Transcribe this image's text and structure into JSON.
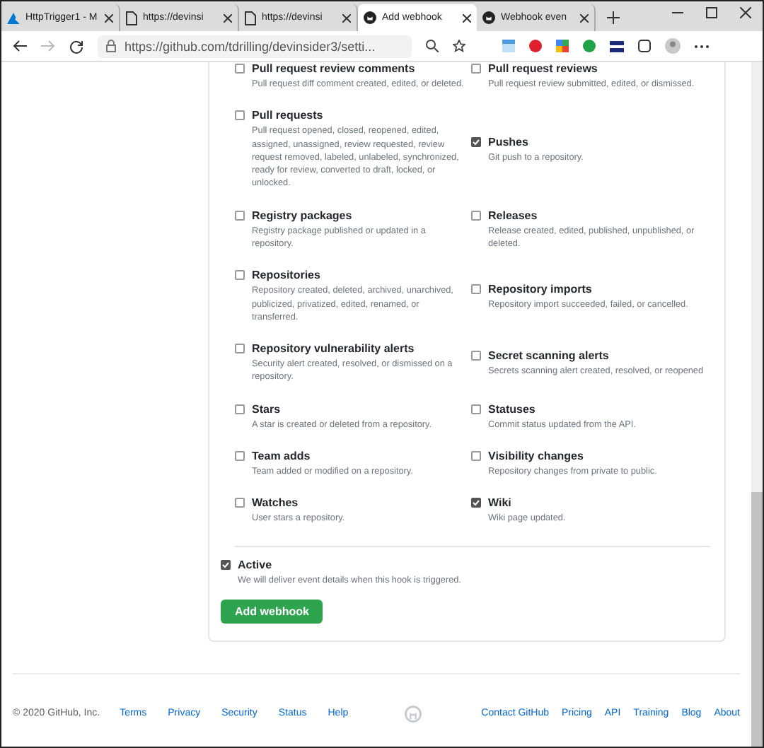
{
  "browser": {
    "tabs": [
      {
        "title": "HttpTrigger1 - M",
        "kind": "azure",
        "selected": false
      },
      {
        "title": "https://devinsi",
        "kind": "page",
        "selected": false
      },
      {
        "title": "https://devinsi",
        "kind": "page",
        "selected": false
      },
      {
        "title": "Add webhook",
        "kind": "github",
        "selected": true
      },
      {
        "title": "Webhook even",
        "kind": "github",
        "selected": false
      }
    ],
    "url": "https://github.com/tdrilling/devinsider3/setti..."
  },
  "events": [
    {
      "title": "Pull request review comments",
      "description": "Pull request diff comment created, edited, or deleted.",
      "checked": false
    },
    {
      "title": "Pull request reviews",
      "description": "Pull request review submitted, edited, or dismissed.",
      "checked": false
    },
    {
      "title": "Pull requests",
      "description": "Pull request opened, closed, reopened, edited, assigned, unassigned, review requested, review request removed, labeled, unlabeled, synchronized, ready for review, converted to draft, locked, or unlocked.",
      "checked": false
    },
    {
      "title": "Pushes",
      "description": "Git push to a repository.",
      "checked": true
    },
    {
      "title": "Registry packages",
      "description": "Registry package published or updated in a repository.",
      "checked": false
    },
    {
      "title": "Releases",
      "description": "Release created, edited, published, unpublished, or deleted.",
      "checked": false
    },
    {
      "title": "Repositories",
      "description": "Repository created, deleted, archived, unarchived, publicized, privatized, edited, renamed, or transferred.",
      "checked": false
    },
    {
      "title": "Repository imports",
      "description": "Repository import succeeded, failed, or cancelled.",
      "checked": false
    },
    {
      "title": "Repository vulnerability alerts",
      "description": "Security alert created, resolved, or dismissed on a repository.",
      "checked": false
    },
    {
      "title": "Secret scanning alerts",
      "description": "Secrets scanning alert created, resolved, or reopened",
      "checked": false
    },
    {
      "title": "Stars",
      "description": "A star is created or deleted from a repository.",
      "checked": false
    },
    {
      "title": "Statuses",
      "description": "Commit status updated from the API.",
      "checked": false
    },
    {
      "title": "Team adds",
      "description": "Team added or modified on a repository.",
      "checked": false
    },
    {
      "title": "Visibility changes",
      "description": "Repository changes from private to public.",
      "checked": false
    },
    {
      "title": "Watches",
      "description": "User stars a repository.",
      "checked": false
    },
    {
      "title": "Wiki",
      "description": "Wiki page updated.",
      "checked": true
    }
  ],
  "active": {
    "label": "Active",
    "description": "We will deliver event details when this hook is triggered.",
    "checked": true
  },
  "submit_button": "Add webhook",
  "footer": {
    "copyright": "© 2020 GitHub, Inc.",
    "left_links": [
      "Terms",
      "Privacy",
      "Security",
      "Status",
      "Help"
    ],
    "right_links": [
      "Contact GitHub",
      "Pricing",
      "API",
      "Training",
      "Blog",
      "About"
    ]
  }
}
